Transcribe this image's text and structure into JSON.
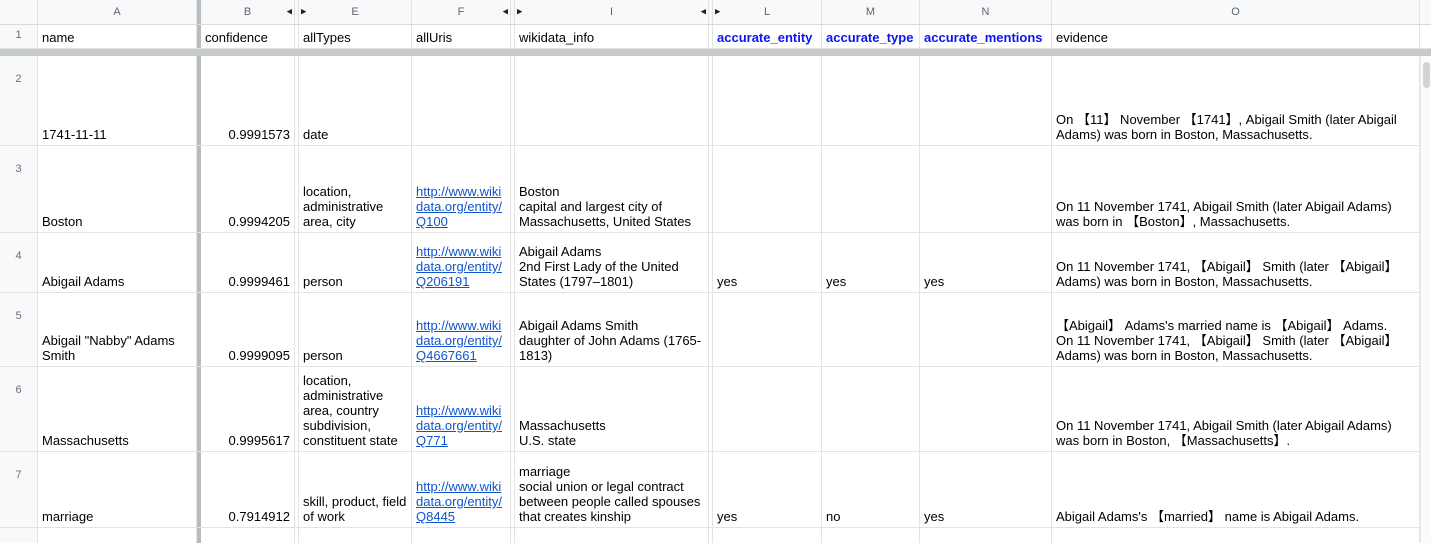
{
  "colors": {
    "header_accent_blue": "#0b16ee",
    "link_blue": "#1155cc",
    "grid_line": "#e2e3e3",
    "header_bg": "#f8f9fa",
    "header_text": "#5f6368",
    "frozen_divider": "#b9bcbe"
  },
  "header_row_num": "1",
  "columns": {
    "a": {
      "letter": "A",
      "title": "name"
    },
    "b": {
      "letter": "B",
      "title": "confidence"
    },
    "e": {
      "letter": "E",
      "title": "allTypes"
    },
    "f": {
      "letter": "F",
      "title": "allUris"
    },
    "i": {
      "letter": "I",
      "title": "wikidata_info"
    },
    "l": {
      "letter": "L",
      "title": "accurate_entity"
    },
    "m": {
      "letter": "M",
      "title": "accurate_type"
    },
    "n": {
      "letter": "N",
      "title": "accurate_mentions"
    },
    "o": {
      "letter": "O",
      "title": "evidence"
    }
  },
  "icons": {
    "collapse_left": "◀",
    "collapse_right": "▶"
  },
  "rows": [
    {
      "num": "2",
      "name": "1741-11-11",
      "confidence": "0.9991573",
      "allTypes": "date",
      "allUris": "",
      "wikidata_info": "",
      "accurate_entity": "",
      "accurate_type": "",
      "accurate_mentions": "",
      "evidence": "On 【11】 November 【1741】, Abigail Smith (later Abigail Adams) was born in Boston, Massachusetts."
    },
    {
      "num": "3",
      "name": "Boston",
      "confidence": "0.9994205",
      "allTypes": "location, administrative area, city",
      "allUris": "http://www.wikidata.org/entity/Q100",
      "wikidata_info": "Boston\ncapital and largest city of Massachusetts, United States",
      "accurate_entity": "",
      "accurate_type": "",
      "accurate_mentions": "",
      "evidence": "On 11 November 1741, Abigail Smith (later Abigail Adams) was born in 【Boston】, Massachusetts."
    },
    {
      "num": "4",
      "name": "Abigail Adams",
      "confidence": "0.9999461",
      "allTypes": "person",
      "allUris": "http://www.wikidata.org/entity/Q206191",
      "wikidata_info": "Abigail Adams\n2nd First Lady of the United States (1797–1801)",
      "accurate_entity": "yes",
      "accurate_type": "yes",
      "accurate_mentions": "yes",
      "evidence": "On 11 November 1741, 【Abigail】 Smith (later 【Abigail】 Adams) was born in Boston, Massachusetts."
    },
    {
      "num": "5",
      "name": "Abigail \"Nabby\" Adams Smith",
      "confidence": "0.9999095",
      "allTypes": "person",
      "allUris": "http://www.wikidata.org/entity/Q4667661",
      "wikidata_info": "Abigail Adams Smith\ndaughter of John Adams (1765-1813)",
      "accurate_entity": "",
      "accurate_type": "",
      "accurate_mentions": "",
      "evidence": "【Abigail】 Adams's married name is 【Abigail】 Adams.\nOn 11 November 1741, 【Abigail】 Smith (later 【Abigail】 Adams) was born in Boston, Massachusetts."
    },
    {
      "num": "6",
      "name": "Massachusetts",
      "confidence": "0.9995617",
      "allTypes": "location, administrative area, country subdivision, constituent state",
      "allUris": "http://www.wikidata.org/entity/Q771",
      "wikidata_info": "Massachusetts\nU.S. state",
      "accurate_entity": "",
      "accurate_type": "",
      "accurate_mentions": "",
      "evidence": "On 11 November 1741, Abigail Smith (later Abigail Adams) was born in Boston, 【Massachusetts】."
    },
    {
      "num": "7",
      "name": "marriage",
      "confidence": "0.7914912",
      "allTypes": "skill, product, field of work",
      "allUris": "http://www.wikidata.org/entity/Q8445",
      "wikidata_info": "marriage\nsocial union or legal contract between people called spouses that creates kinship",
      "accurate_entity": "yes",
      "accurate_type": "no",
      "accurate_mentions": "yes",
      "evidence": "Abigail Adams's 【married】 name is Abigail Adams."
    }
  ]
}
